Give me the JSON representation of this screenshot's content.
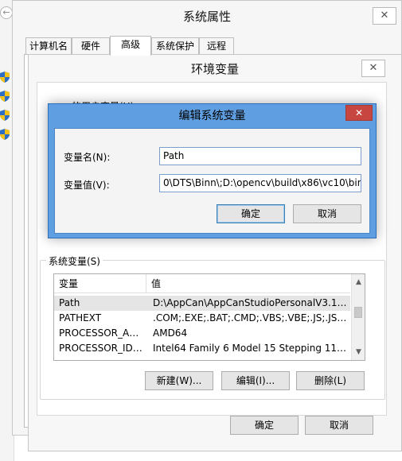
{
  "system_properties": {
    "title": "系统属性",
    "close_glyph": "✕",
    "tabs": [
      {
        "label": "计算机名"
      },
      {
        "label": "硬件"
      },
      {
        "label": "高级"
      },
      {
        "label": "系统保护"
      },
      {
        "label": "远程"
      }
    ]
  },
  "env_dialog": {
    "title": "环境变量",
    "close_glyph": "✕",
    "user_vars_label": "——的用户变量(U)",
    "system_vars_label": "系统变量(S)",
    "table_headers": {
      "name": "变量",
      "value": "值"
    },
    "rows": [
      {
        "name": "Path",
        "value": "D:\\AppCan\\AppCanStudioPersonalV3.1\\..."
      },
      {
        "name": "PATHEXT",
        "value": ".COM;.EXE;.BAT;.CMD;.VBS;.VBE;.JS;.JSE;..."
      },
      {
        "name": "PROCESSOR_AR...",
        "value": "AMD64"
      },
      {
        "name": "PROCESSOR_IDE...",
        "value": "Intel64 Family 6 Model 15 Stepping 11, ..."
      }
    ],
    "buttons": {
      "new": "新建(W)...",
      "edit": "编辑(I)...",
      "delete": "删除(L)"
    },
    "ok": "确定",
    "cancel": "取消"
  },
  "edit_dialog": {
    "title": "编辑系统变量",
    "close_glyph": "✕",
    "name_label": "变量名(N):",
    "value_label": "变量值(V):",
    "name_value": "Path",
    "value_value": "0\\DTS\\Binn\\;D:\\opencv\\build\\x86\\vc10\\bin",
    "ok": "确定",
    "cancel": "取消"
  },
  "scroll_glyphs": {
    "up": "▲",
    "down": "▼"
  },
  "icons": {
    "back": "back-arrow-icon",
    "shield": "uac-shield-icon"
  },
  "colors": {
    "edit_title_bar": "#5f9ee0",
    "close_button": "#c7463f"
  }
}
